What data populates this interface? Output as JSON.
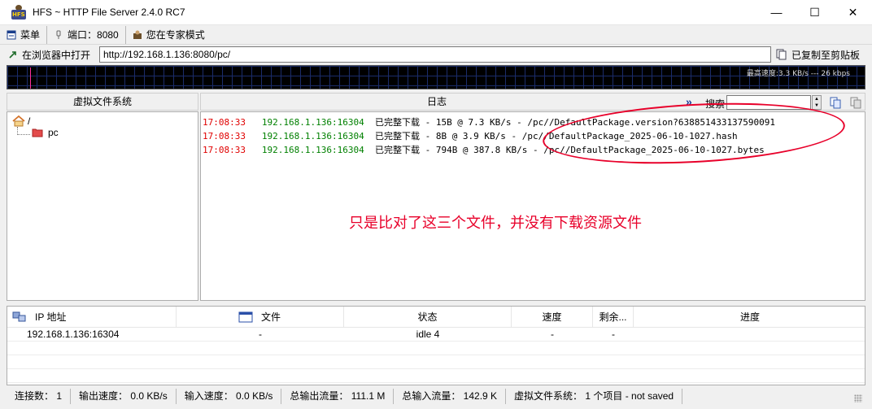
{
  "window": {
    "title": "HFS ~ HTTP File Server 2.4.0 RC7",
    "min_glyph": "—",
    "max_glyph": "☐",
    "close_glyph": "✕"
  },
  "menubar": {
    "menu": "菜单",
    "port": "端口：8080",
    "expert": "您在专家模式"
  },
  "urlbar": {
    "open_browser": "在浏览器中打开",
    "url": "http://192.168.1.136:8080/pc/",
    "copied": "已复制至剪贴板"
  },
  "graph": {
    "label": "最高速度:3.3 KB/s  ---  26 kbps"
  },
  "vfs": {
    "header": "虚拟文件系统",
    "root": "/",
    "child": "pc"
  },
  "log": {
    "header": "日志",
    "arrows": "»",
    "search_label": "搜索",
    "spin_up": "▲",
    "spin_down": "▼",
    "lines": [
      {
        "time": "17:08:33",
        "ip": "192.168.1.136:16304",
        "msg": "已完整下载 - 15B @ 7.3 KB/s - /pc//DefaultPackage.version?638851433137590091"
      },
      {
        "time": "17:08:33",
        "ip": "192.168.1.136:16304",
        "msg": "已完整下载 - 8B @ 3.9 KB/s - /pc//DefaultPackage_2025-06-10-1027.hash"
      },
      {
        "time": "17:08:33",
        "ip": "192.168.1.136:16304",
        "msg": "已完整下载 - 794B @ 387.8 KB/s - /pc//DefaultPackage_2025-06-10-1027.bytes"
      }
    ],
    "annotation": "只是比对了这三个文件，并没有下载资源文件"
  },
  "connections": {
    "columns": {
      "ip": "IP 地址",
      "file": "文件",
      "status": "状态",
      "speed": "速度",
      "remaining": "剩余...",
      "progress": "进度"
    },
    "rows": [
      {
        "ip": "192.168.1.136:16304",
        "file": "-",
        "status": "idle 4",
        "speed": "-",
        "remaining": "-",
        "progress": ""
      }
    ]
  },
  "statusbar": {
    "connections": "连接数： 1",
    "out_speed": "输出速度： 0.0 KB/s",
    "in_speed": "输入速度： 0.0 KB/s",
    "total_out": "总输出流量： 111.1 M",
    "total_in": "总输入流量： 142.9 K",
    "vfs": "虚拟文件系统： 1 个项目 - not saved"
  },
  "colors": {
    "log_time": "#e00000",
    "log_ip": "#008000",
    "annotation": "#e8002a",
    "graph_spike": "#ff2e9c"
  }
}
